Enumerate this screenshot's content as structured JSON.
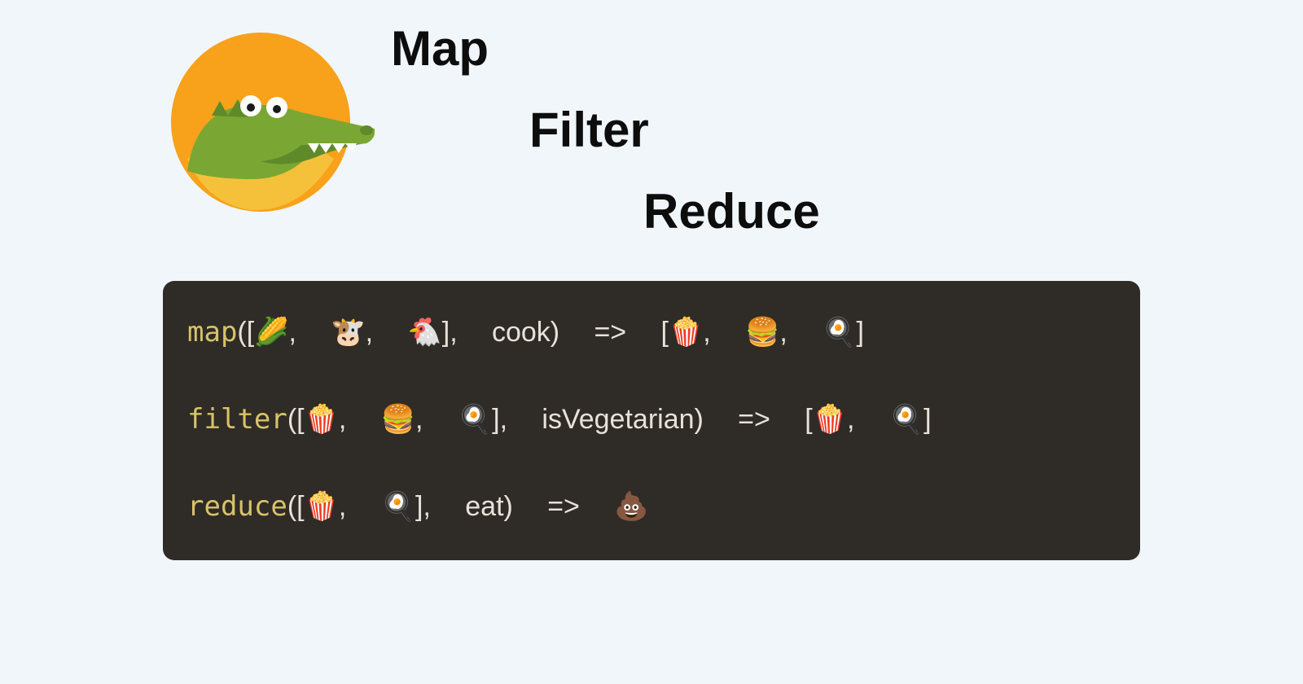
{
  "titles": {
    "map": "Map",
    "filter": "Filter",
    "reduce": "Reduce"
  },
  "code": {
    "lines": [
      {
        "fn": "map",
        "rest": "([🌽, 🐮, 🐔], cook) => [🍿, 🍔, 🍳]"
      },
      {
        "fn": "filter",
        "rest": "([🍿, 🍔, 🍳], isVegetarian) =>  [🍿, 🍳]"
      },
      {
        "fn": "reduce",
        "rest": "([🍿, 🍳], eat) => 💩"
      }
    ]
  },
  "colors": {
    "bg": "#f1f6fb",
    "code_bg": "#2f2b26",
    "code_text": "#e7e2da",
    "code_fn": "#d7c36a",
    "sun": "#f8a11a",
    "gator_green": "#7aa733",
    "gator_dark": "#5f8a2a",
    "sun_inner": "#f6c13a"
  }
}
